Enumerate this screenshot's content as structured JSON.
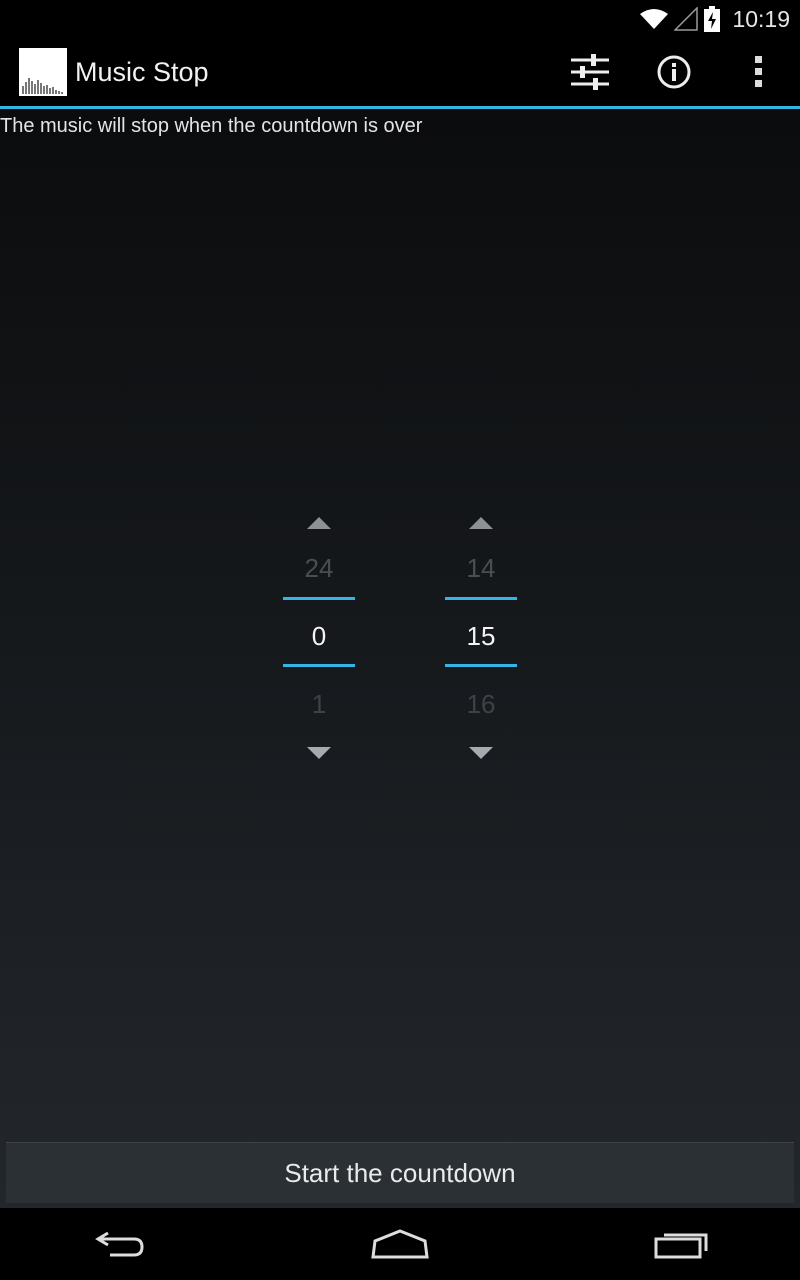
{
  "status_bar": {
    "time": "10:19",
    "icons": [
      "wifi-icon",
      "signal-icon",
      "battery-charging-icon"
    ]
  },
  "action_bar": {
    "title": "Music Stop",
    "logo_icon": "equalizer-logo-icon",
    "actions": [
      "settings-sliders-icon",
      "info-icon",
      "overflow-menu-icon"
    ],
    "accent_color": "#33b5e5"
  },
  "instruction": "The music will stop when the countdown is over",
  "pickers": {
    "hours": {
      "prev": "24",
      "current": "0",
      "next": "1"
    },
    "minutes": {
      "prev": "14",
      "current": "15",
      "next": "16"
    }
  },
  "start_button": {
    "label": "Start the countdown"
  },
  "nav_bar": {
    "icons": [
      "back-icon",
      "home-icon",
      "recent-apps-icon"
    ]
  }
}
